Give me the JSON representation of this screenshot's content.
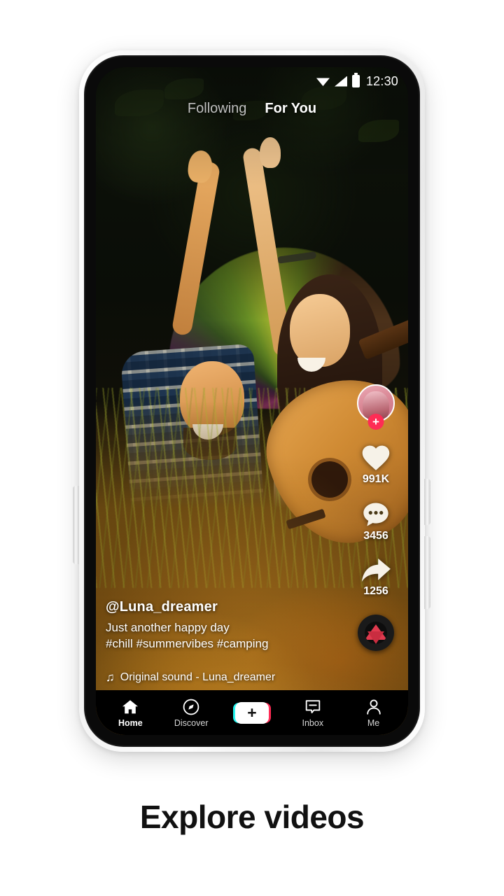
{
  "page": {
    "caption": "Explore videos",
    "background_color": "#ffffff"
  },
  "device": {
    "frame_color": "#f2f2f2",
    "bezel_color": "#0a0a0a"
  },
  "status_bar": {
    "time": "12:30",
    "icons": [
      "wifi-icon",
      "cellular-signal-icon",
      "battery-icon"
    ]
  },
  "feed_tabs": {
    "following": "Following",
    "for_you": "For You",
    "active": "For You"
  },
  "video": {
    "scene": "campfire-night-couple-with-guitar",
    "creator_handle": "@Luna_dreamer",
    "caption_line1": "Just another happy day",
    "caption_line2": "#chill #summervibes #camping",
    "music_note_icon": "♫",
    "music_label": "Original sound - Luna_dreamer"
  },
  "actions": {
    "avatar": {
      "name": "creator-avatar",
      "follow_badge": "+",
      "follow_badge_color": "#fe2c55"
    },
    "like": {
      "icon": "heart-icon",
      "count": "991K"
    },
    "comment": {
      "icon": "comment-bubble-icon",
      "count": "3456"
    },
    "share": {
      "icon": "share-arrow-icon",
      "count": "1256"
    },
    "sound_disc": {
      "icon": "vinyl-record-icon"
    }
  },
  "bottom_nav": {
    "items": [
      {
        "label": "Home",
        "icon": "home-icon",
        "active": true
      },
      {
        "label": "Discover",
        "icon": "compass-icon",
        "active": false
      },
      {
        "label": "Inbox",
        "icon": "inbox-icon",
        "active": false
      },
      {
        "label": "Me",
        "icon": "person-icon",
        "active": false
      }
    ],
    "create_button": {
      "label": "+",
      "left_color": "#25f4ee",
      "right_color": "#fe2c55"
    }
  },
  "colors": {
    "accent_pink": "#fe2c55",
    "accent_cyan": "#25f4ee",
    "nav_background": "#000000"
  }
}
